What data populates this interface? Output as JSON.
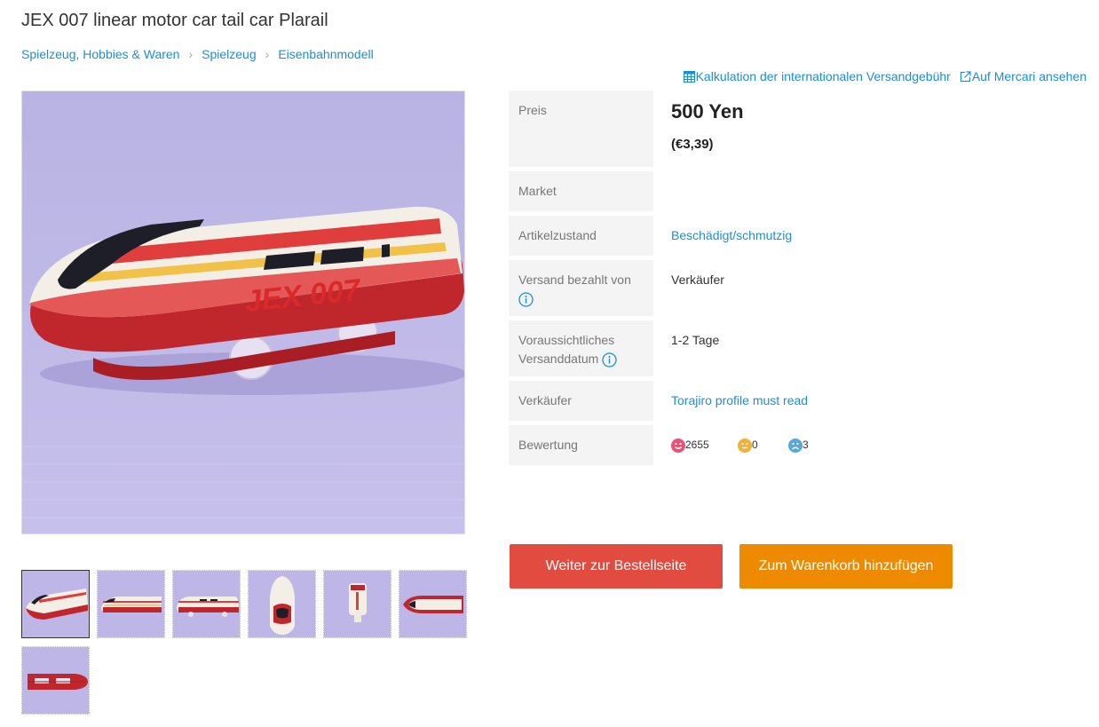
{
  "product": {
    "title": "JEX 007 linear motor car tail car Plarail"
  },
  "breadcrumb": [
    "Spielzeug, Hobbies & Waren",
    "Spielzeug",
    "Eisenbahnmodell"
  ],
  "toplinks": {
    "shipping_calc": "Kalkulation der internationalen Versandgebühr",
    "mercari": "Auf Mercari ansehen"
  },
  "details": {
    "price_label": "Preis",
    "price": "500 Yen",
    "price_eur": "(€3,39)",
    "market_label": "Market",
    "market_value": "",
    "condition_label": "Artikelzustand",
    "condition_value": "Beschädigt/schmutzig",
    "shipping_paid_label": "Versand bezahlt von",
    "shipping_paid_value": "Verkäufer",
    "ship_date_label_1": "Voraussichtliches",
    "ship_date_label_2": "Versanddatum",
    "ship_date_value": "1-2 Tage",
    "seller_label": "Verkäufer",
    "seller_value": "Torajiro profile must read",
    "rating_label": "Bewertung",
    "rating_good": "2655",
    "rating_normal": "0",
    "rating_bad": "3"
  },
  "buttons": {
    "order": "Weiter zur Bestellseite",
    "cart": "Zum Warenkorb hinzufügen"
  },
  "colors": {
    "link": "#1a8fd6",
    "order_button": "#e14b40",
    "cart_button": "#ee8a00",
    "rating_good": "#e8537a",
    "rating_normal": "#f2b23a",
    "rating_bad": "#5aa8d8"
  }
}
